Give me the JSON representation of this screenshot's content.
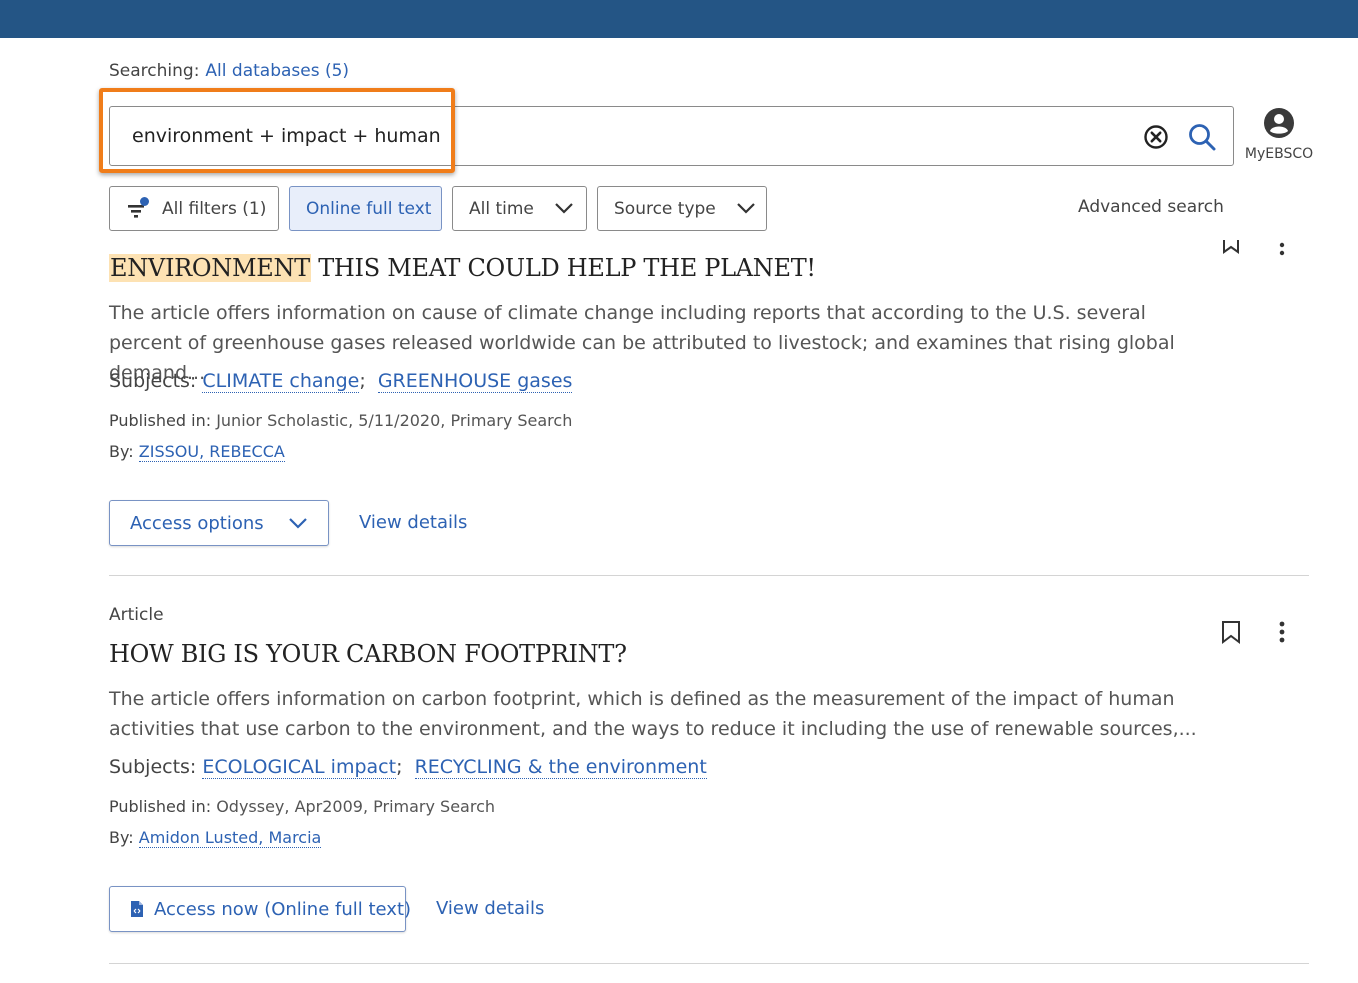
{
  "search": {
    "searching_label": "Searching:",
    "databases_link": "All databases (5)",
    "query": "environment + impact + human"
  },
  "user": {
    "label": "MyEBSCO"
  },
  "filters": {
    "all_filters": "All filters (1)",
    "online_full_text": "Online full text",
    "all_time": "All time",
    "source_type": "Source type",
    "advanced_search": "Advanced search"
  },
  "results": [
    {
      "title_highlight": "ENVIRONMENT",
      "title_rest": " THIS MEAT COULD HELP THE PLANET!",
      "abstract": "The article offers information on cause of climate change including reports that according to the U.S. several percent of greenhouse gases released worldwide can be attributed to livestock; and examines that rising global demand...",
      "subjects_label": "Subjects:",
      "subjects": [
        "CLIMATE change",
        "GREENHOUSE gases"
      ],
      "published_label": "Published in:",
      "published": "Junior Scholastic, 5/11/2020, Primary Search",
      "by_label": "By:",
      "author": "ZISSOU, REBECCA",
      "access_label": "Access options",
      "view_details": "View details"
    },
    {
      "type": "Article",
      "title": "HOW BIG IS YOUR CARBON FOOTPRINT?",
      "abstract": "The article offers information on carbon footprint, which is defined as the measurement of the impact of human activities that use carbon to the environment, and the ways to reduce it including the use of renewable sources,...",
      "subjects_label": "Subjects:",
      "subjects": [
        "ECOLOGICAL impact",
        "RECYCLING & the environment"
      ],
      "published_label": "Published in:",
      "published": "Odyssey, Apr2009, Primary Search",
      "by_label": "By:",
      "author": "Amidon Lusted, Marcia",
      "access_label": "Access now (Online full text)",
      "view_details": "View details"
    }
  ],
  "colors": {
    "topbar": "#245585",
    "link": "#2d62b3",
    "highlight_frame": "#f07d1a",
    "term_highlight": "#fde2b3"
  }
}
